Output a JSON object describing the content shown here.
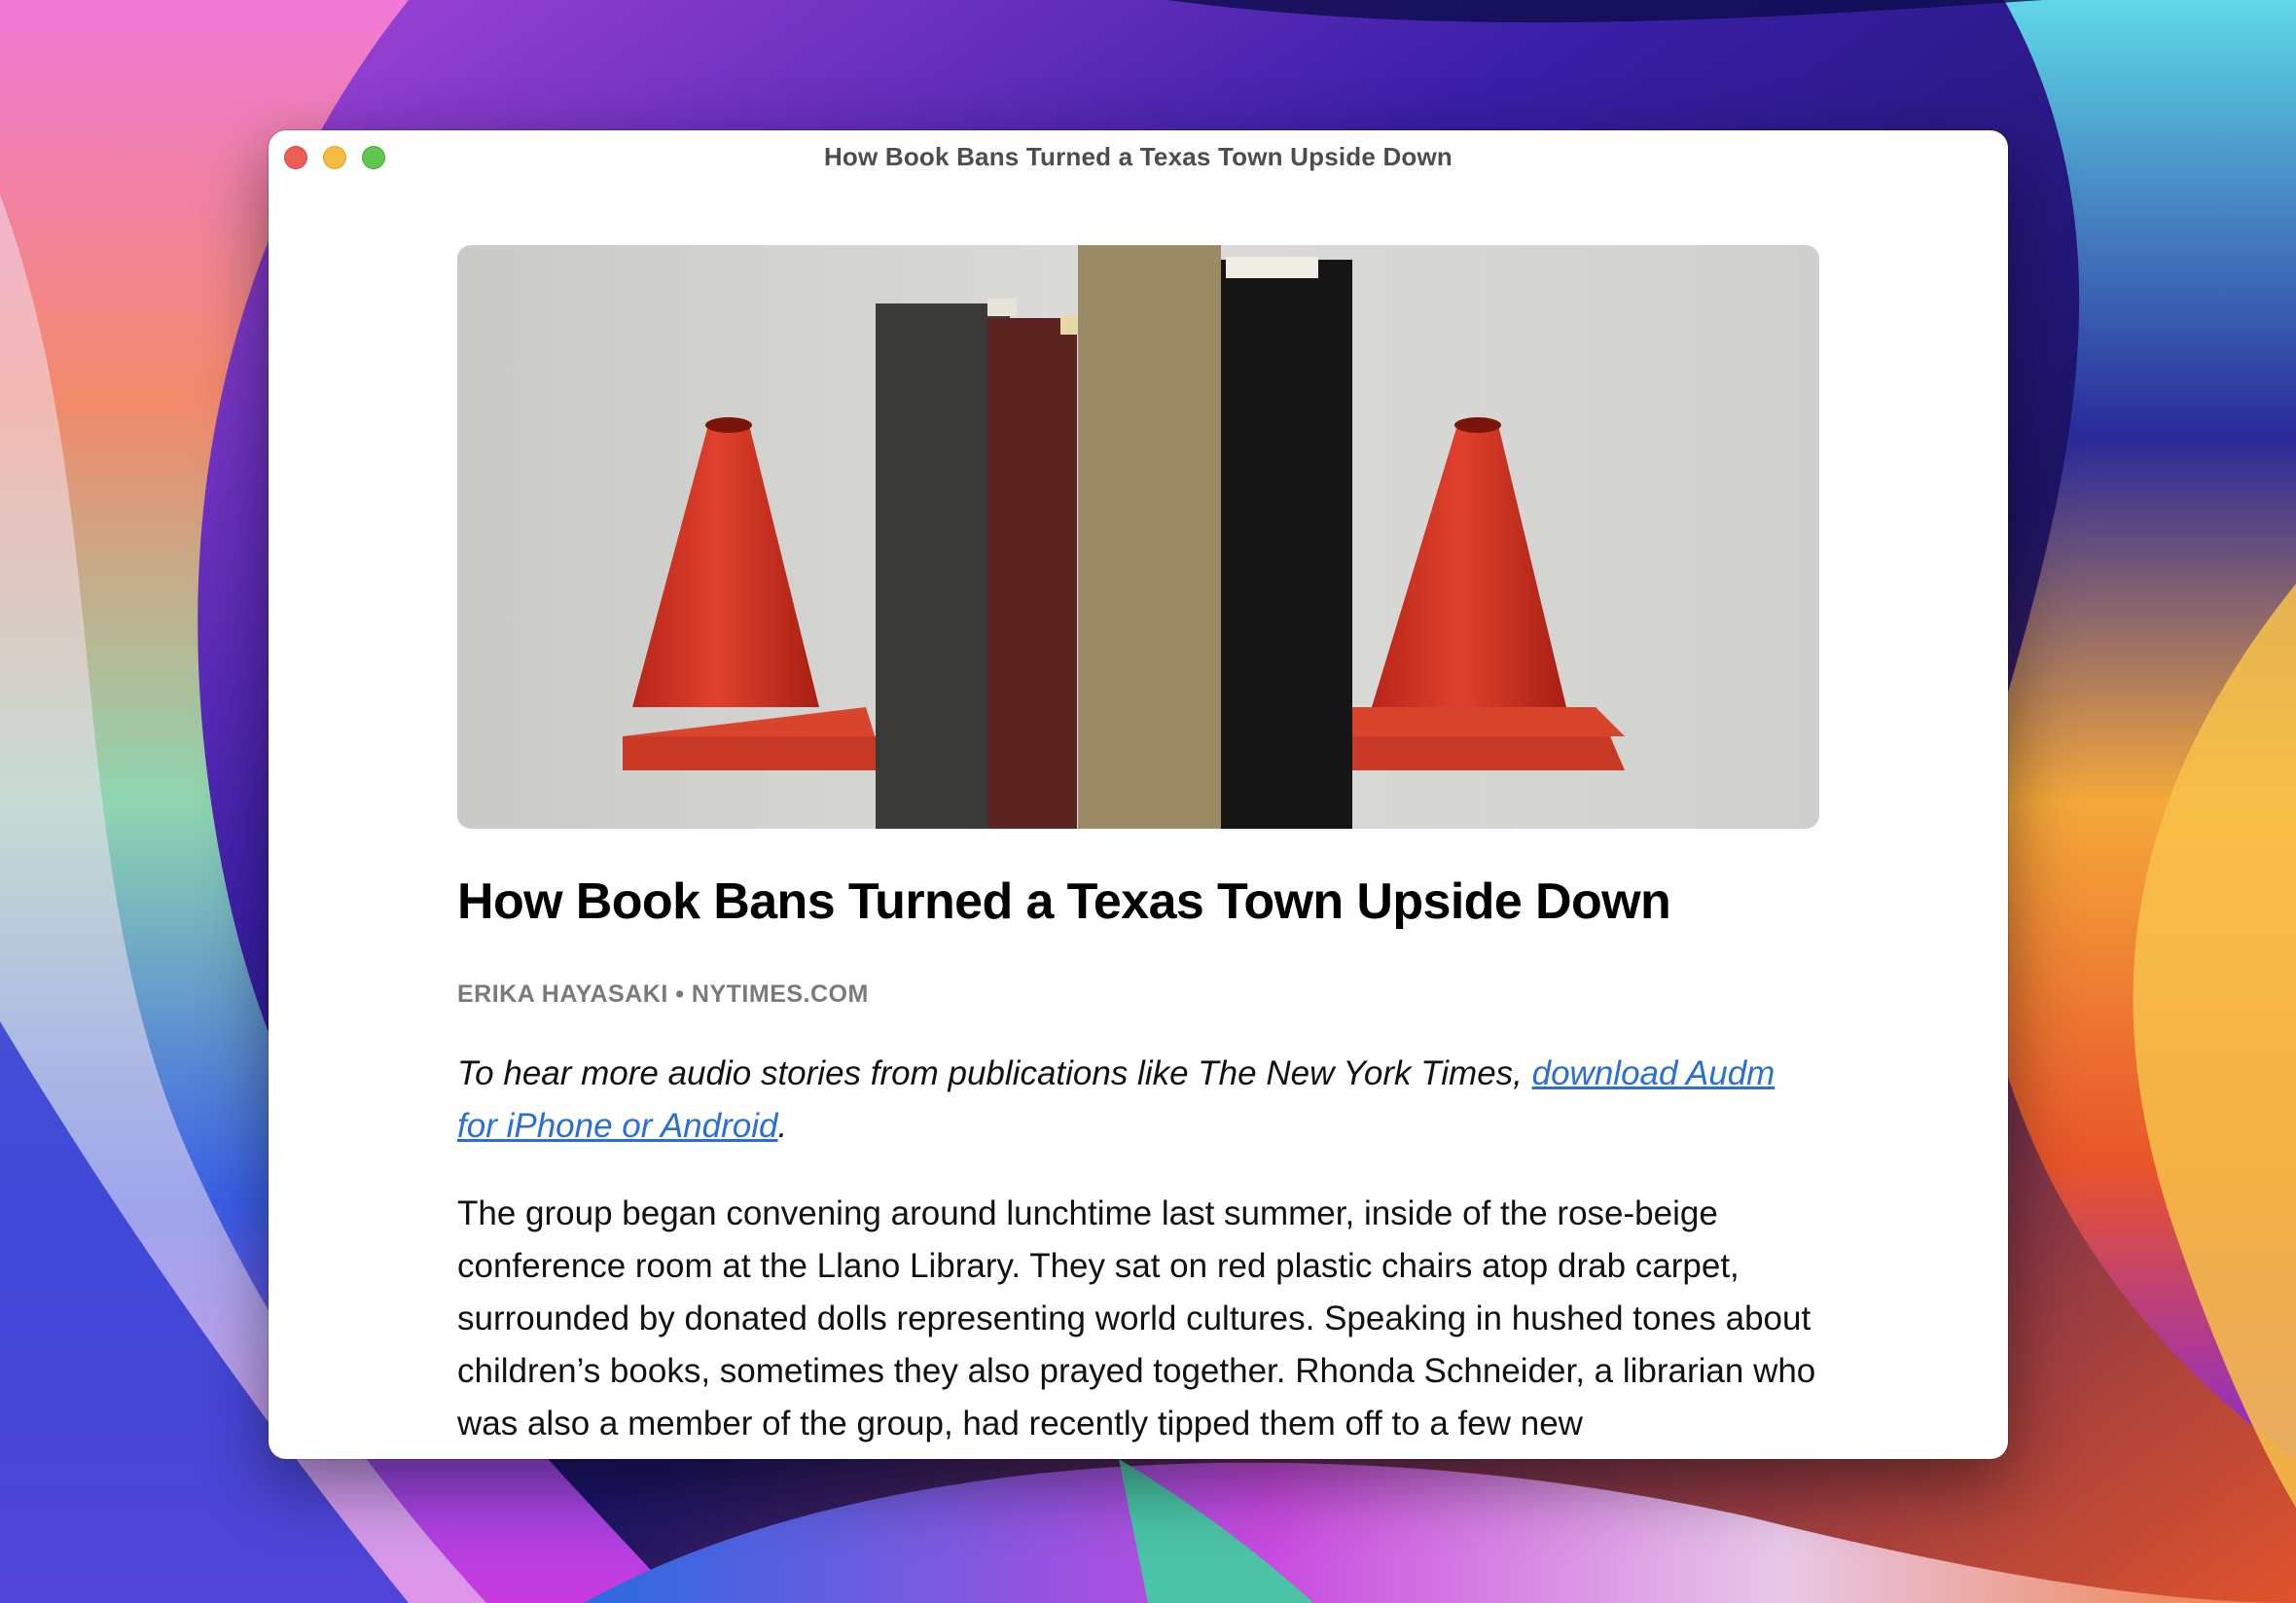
{
  "window": {
    "title": "How Book Bans Turned a Texas Town Upside Down"
  },
  "article": {
    "hero_image": "red-traffic-cones-and-books-photo",
    "headline": "How Book Bans Turned a Texas Town Upside Down",
    "byline": "ERIKA HAYASAKI • NYTIMES.COM",
    "intro": {
      "text": "To hear more audio stories from publications like The New York Times, ",
      "link": "download Audm for iPhone or Android",
      "after": "."
    },
    "paragraph": "The group began convening around lunchtime last summer, inside of the rose-beige conference room at the Llano Library. They sat on red plastic chairs atop drab carpet, surrounded by donated dolls representing world cultures. Speaking in hushed tones about children’s books, sometimes they also prayed together. Rhonda Schneider, a librarian who was also a member of the group, had recently tipped them off to a few new"
  },
  "colors": {
    "traffic_close": "#ec5f57",
    "traffic_minimize": "#f4bd40",
    "traffic_maximize": "#5fc650",
    "link": "#2a6fd6"
  }
}
